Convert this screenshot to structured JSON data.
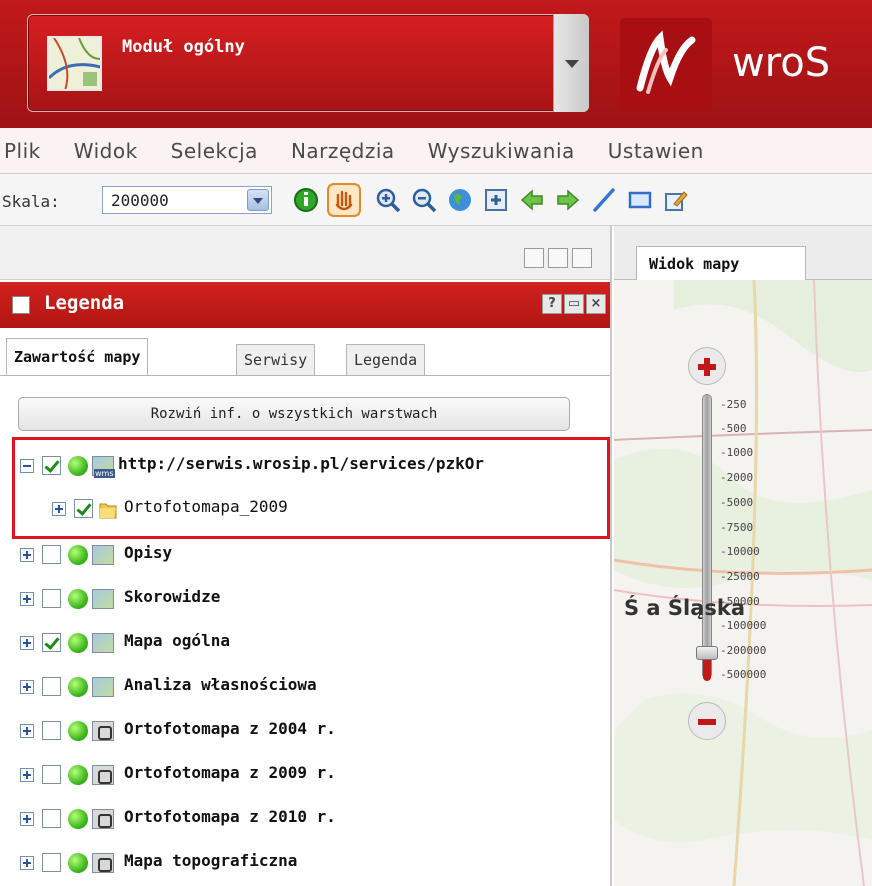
{
  "header": {
    "module_label": "Moduł ogólny",
    "brand_text": "wroS",
    "accent_color": "#c2191b"
  },
  "menu": {
    "items": [
      {
        "label": "Plik"
      },
      {
        "label": "Widok"
      },
      {
        "label": "Selekcja"
      },
      {
        "label": "Narzędzia"
      },
      {
        "label": "Wyszukiwania"
      },
      {
        "label": "Ustawien"
      }
    ]
  },
  "toolbar": {
    "scale_label": "Skala:",
    "scale_value": "200000",
    "icons": [
      "info-icon",
      "pan-hand-icon",
      "zoom-in-icon",
      "zoom-out-icon",
      "globe-icon",
      "full-extent-icon",
      "back-arrow-icon",
      "forward-arrow-icon",
      "measure-line-icon",
      "rectangle-select-icon",
      "edit-icon"
    ]
  },
  "legend_panel": {
    "title": "Legenda",
    "tabs": [
      {
        "label": "Zawartość mapy",
        "active": true
      },
      {
        "label": "Serwisy",
        "active": false
      },
      {
        "label": "Legenda",
        "active": false
      }
    ],
    "expand_all_label": "Rozwiń inf. o wszystkich warstwach",
    "layers": [
      {
        "label": "http://serwis.wrosip.pl/services/pzkOr",
        "checked": true,
        "expanded": true,
        "type": "wms",
        "bold": true
      },
      {
        "label": "Ortofotomapa_2009",
        "checked": true,
        "expanded": false,
        "type": "folder",
        "bold": false
      },
      {
        "label": "Opisy",
        "checked": false,
        "expanded": false,
        "type": "layer",
        "bold": true
      },
      {
        "label": "Skorowidze",
        "checked": false,
        "expanded": false,
        "type": "layer",
        "bold": true
      },
      {
        "label": "Mapa ogólna",
        "checked": true,
        "expanded": false,
        "type": "layer",
        "bold": true
      },
      {
        "label": "Analiza własnościowa",
        "checked": false,
        "expanded": false,
        "type": "layer",
        "bold": true
      },
      {
        "label": "Ortofotomapa z 2004 r.",
        "checked": false,
        "expanded": false,
        "type": "cache",
        "bold": true
      },
      {
        "label": "Ortofotomapa z 2009 r.",
        "checked": false,
        "expanded": false,
        "type": "cache",
        "bold": true
      },
      {
        "label": "Ortofotomapa z 2010 r.",
        "checked": false,
        "expanded": false,
        "type": "cache",
        "bold": true
      },
      {
        "label": "Mapa topograficzna",
        "checked": false,
        "expanded": false,
        "type": "cache",
        "bold": true
      }
    ]
  },
  "map": {
    "tab_label": "Widok mapy",
    "scale_ticks": [
      "-250",
      "-500",
      "-1000",
      "-2000",
      "-5000",
      "-7500",
      "-10000",
      "-25000",
      "-50000",
      "-100000",
      "-200000",
      "-500000"
    ],
    "place_label": "Ś  a Śląska"
  }
}
